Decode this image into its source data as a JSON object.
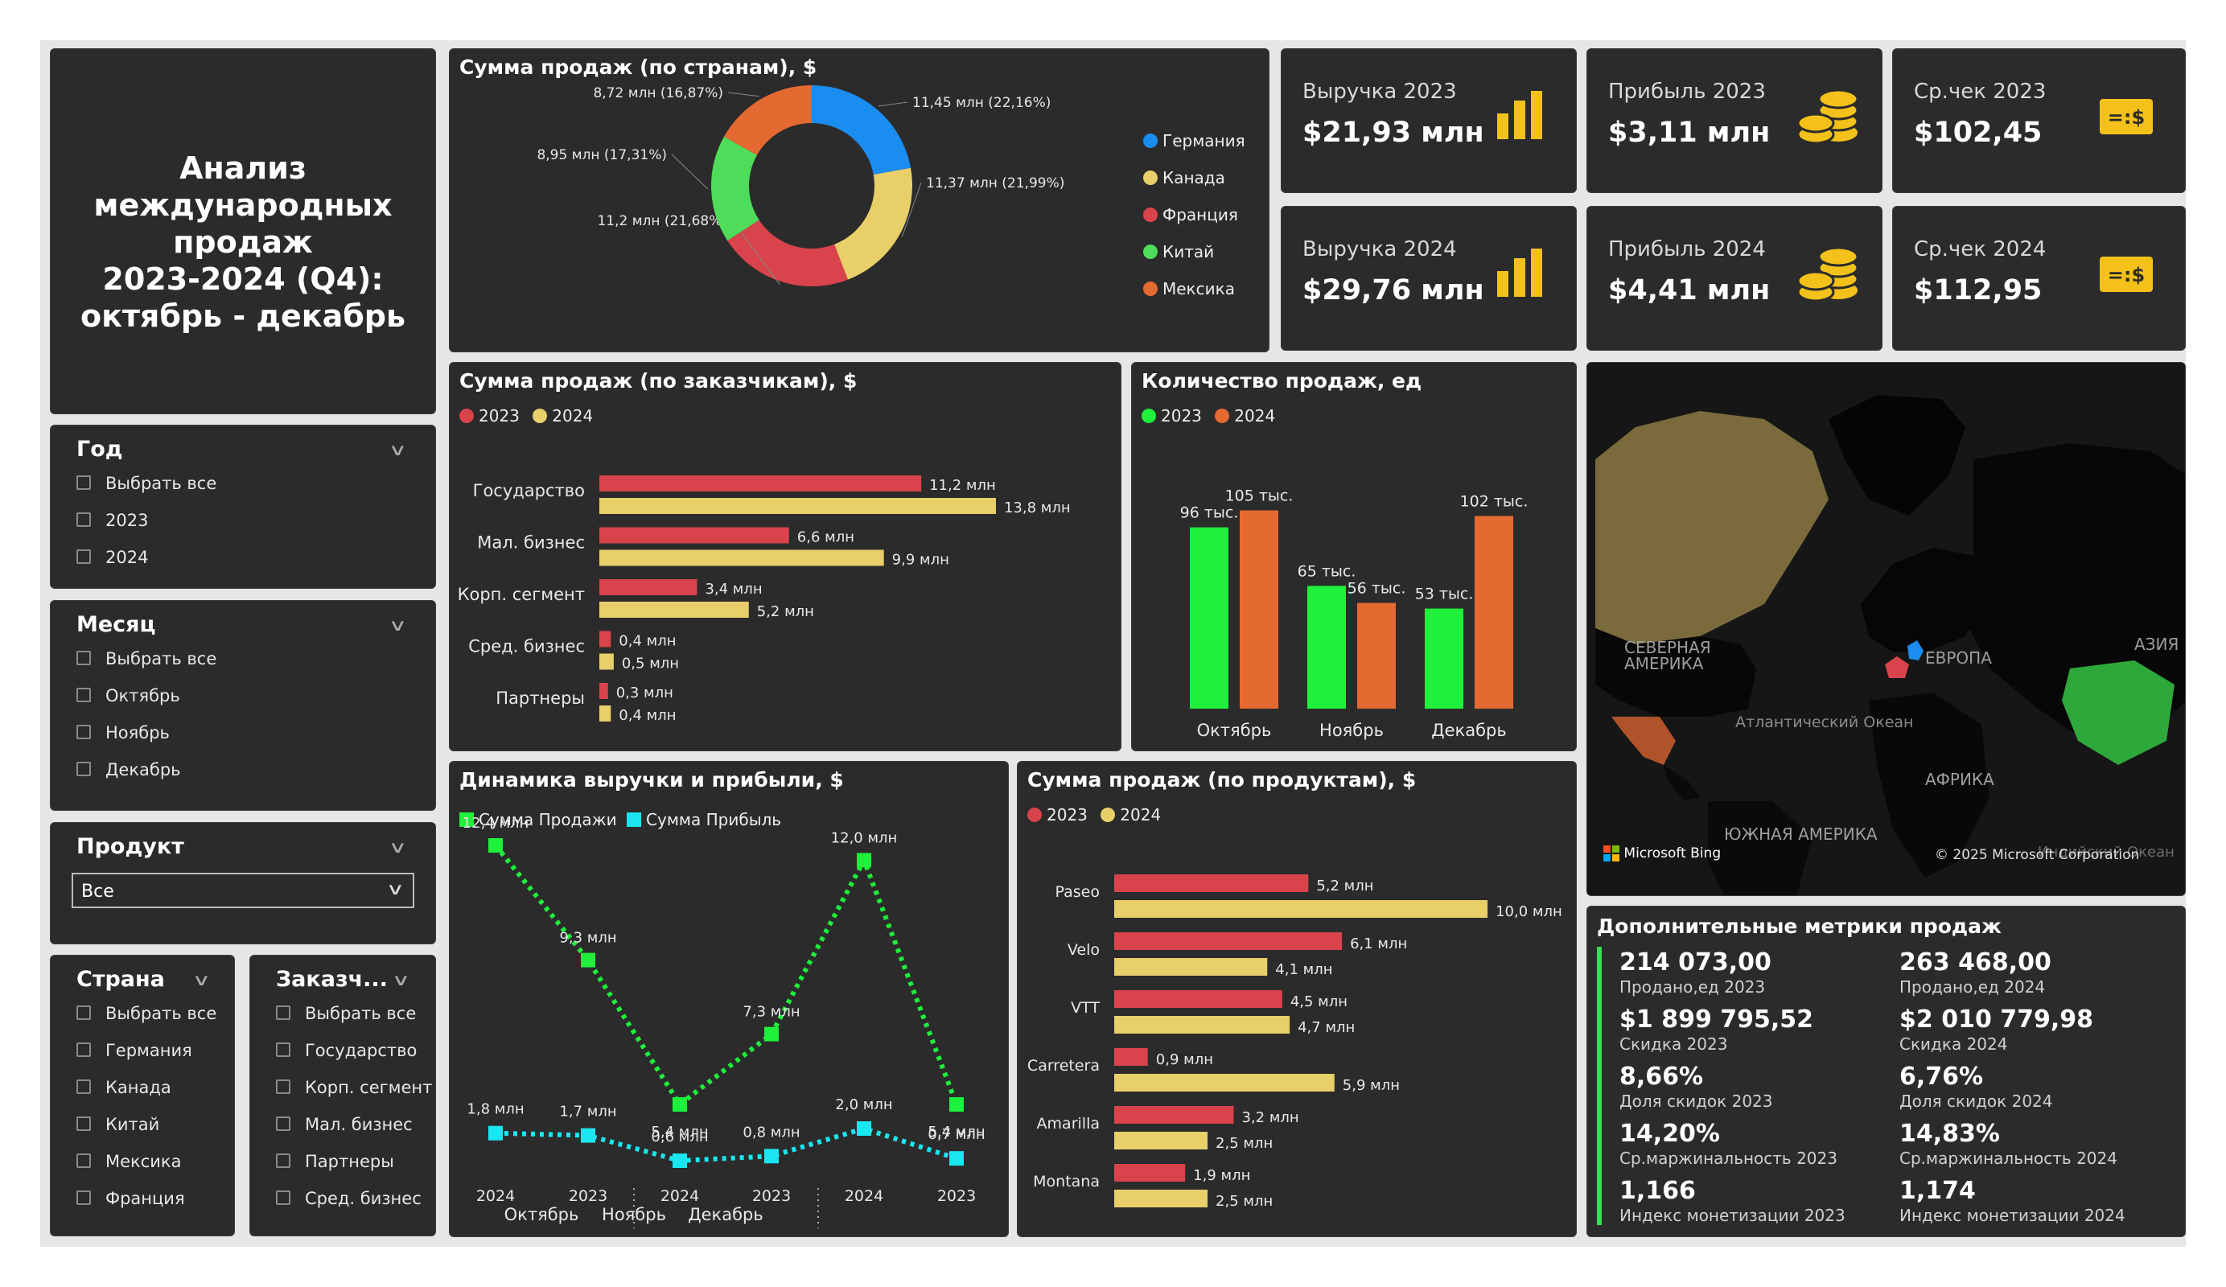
{
  "title_block": {
    "line1": "Анализ",
    "line2": "международных",
    "line3": "продаж",
    "line4": "2023-2024 (Q4):",
    "line5": "октябрь - декабрь"
  },
  "slicers": {
    "year": {
      "title": "Год",
      "options": [
        "Выбрать все",
        "2023",
        "2024"
      ]
    },
    "month": {
      "title": "Месяц",
      "options": [
        "Выбрать все",
        "Октябрь",
        "Ноябрь",
        "Декабрь"
      ]
    },
    "product": {
      "title": "Продукт",
      "selected": "Все"
    },
    "country": {
      "title": "Страна",
      "options": [
        "Выбрать все",
        "Германия",
        "Канада",
        "Китай",
        "Мексика",
        "Франция"
      ]
    },
    "customer": {
      "title": "Заказч...",
      "options": [
        "Выбрать все",
        "Государство",
        "Корп. сегмент",
        "Мал. бизнес",
        "Партнеры",
        "Сред. бизнес"
      ]
    }
  },
  "kpis": {
    "rev23": {
      "label": "Выручка 2023",
      "value": "$21,93 млн",
      "icon": "bar-chart-icon"
    },
    "prof23": {
      "label": "Прибыль 2023",
      "value": "$3,11 млн",
      "icon": "coins-icon"
    },
    "chk23": {
      "label": "Ср.чек 2023",
      "value": "$102,45",
      "icon": "cash-icon"
    },
    "rev24": {
      "label": "Выручка 2024",
      "value": "$29,76 млн",
      "icon": "bar-chart-icon"
    },
    "prof24": {
      "label": "Прибыль 2024",
      "value": "$4,41 млн",
      "icon": "coins-icon"
    },
    "chk24": {
      "label": "Ср.чек 2024",
      "value": "$112,95",
      "icon": "cash-icon"
    }
  },
  "colors": {
    "y2023": "#d9434b",
    "y2024": "#e8cf6a",
    "green": "#1ef03b",
    "orange": "#e46a32",
    "cyan": "#19e6f0",
    "germany": "#1b8cf0",
    "canada": "#e8cf6a",
    "france": "#d9434b",
    "china": "#4fdc5a",
    "mexico": "#e46a32"
  },
  "donut": {
    "title": "Сумма продаж (по странам), $",
    "legend": [
      "Германия",
      "Канада",
      "Франция",
      "Китай",
      "Мексика"
    ],
    "labels": [
      "11,45 млн (22,16%)",
      "11,37 млн (21,99%)",
      "11,2 млн (21,68%)",
      "8,95 млн (17,31%)",
      "8,72 млн (16,87%)"
    ]
  },
  "customers": {
    "title": "Сумма продаж (по заказчикам), $",
    "legend": [
      "2023",
      "2024"
    ],
    "categories": [
      "Государство",
      "Мал. бизнес",
      "Корп. сегмент",
      "Сред. бизнес",
      "Партнеры"
    ],
    "labels2023": [
      "11,2 млн",
      "6,6 млн",
      "3,4 млн",
      "0,4 млн",
      "0,3 млн"
    ],
    "labels2024": [
      "13,8 млн",
      "9,9 млн",
      "5,2 млн",
      "0,5 млн",
      "0,4 млн"
    ]
  },
  "count": {
    "title": "Количество продаж, ед",
    "legend": [
      "2023",
      "2024"
    ],
    "categories": [
      "Октябрь",
      "Ноябрь",
      "Декабрь"
    ],
    "labels2023": [
      "96 тыс.",
      "65 тыс.",
      "53 тыс."
    ],
    "labels2024": [
      "105 тыс.",
      "56 тыс.",
      "102 тыс."
    ]
  },
  "map": {
    "labels": [
      "СЕВЕРНАЯ АМЕРИКА",
      "ЕВРОПА",
      "АЗИЯ",
      "Атлантический Океан",
      "АФРИКА",
      "ЮЖНАЯ АМЕРИКА",
      "Индийский Океан"
    ],
    "bing": "Microsoft Bing",
    "copyright": "© 2025 Microsoft Corporation"
  },
  "dynamics": {
    "title": "Динамика выручки и прибыли, $",
    "legend": [
      "Сумма Продажи",
      "Сумма Прибыль"
    ],
    "years": [
      "2024",
      "2023",
      "2024",
      "2023",
      "2024",
      "2023"
    ],
    "months": [
      "Октябрь",
      "Ноябрь",
      "Декабрь"
    ],
    "sales_labels": [
      "12,4 млн",
      "9,3 млн",
      "5,4 млн",
      "7,3 млн",
      "12,0 млн",
      "5,4 млн"
    ],
    "profit_labels": [
      "1,8 млн",
      "1,7 млн",
      "0,6 млн",
      "0,8 млн",
      "2,0 млн",
      "0,7 млн"
    ]
  },
  "products": {
    "title": "Сумма продаж (по продуктам), $",
    "legend": [
      "2023",
      "2024"
    ],
    "categories": [
      "Paseo",
      "Velo",
      "VTT",
      "Carretera",
      "Amarilla",
      "Montana"
    ],
    "labels2023": [
      "5,2 млн",
      "6,1 млн",
      "4,5 млн",
      "0,9 млн",
      "3,2 млн",
      "1,9 млн"
    ],
    "labels2024": [
      "10,0 млн",
      "4,1 млн",
      "4,7 млн",
      "5,9 млн",
      "2,5 млн",
      "2,5 млн"
    ]
  },
  "metrics": {
    "title": "Дополнительные метрики продаж",
    "left": [
      {
        "value": "214 073,00",
        "label": "Продано,ед 2023"
      },
      {
        "value": "$1 899 795,52",
        "label": "Скидка 2023"
      },
      {
        "value": "8,66%",
        "label": "Доля скидок 2023"
      },
      {
        "value": "14,20%",
        "label": "Ср.маржинальность 2023"
      },
      {
        "value": "1,166",
        "label": "Индекс монетизации 2023"
      }
    ],
    "right": [
      {
        "value": "263 468,00",
        "label": "Продано,ед 2024"
      },
      {
        "value": "$2 010 779,98",
        "label": "Скидка 2024"
      },
      {
        "value": "6,76%",
        "label": "Доля скидок 2024"
      },
      {
        "value": "14,83%",
        "label": "Ср.маржинальность 2024"
      },
      {
        "value": "1,174",
        "label": "Индекс монетизации 2024"
      }
    ]
  },
  "chart_data": [
    {
      "type": "pie",
      "title": "Сумма продаж (по странам), $",
      "categories": [
        "Германия",
        "Канада",
        "Франция",
        "Китай",
        "Мексика"
      ],
      "values": [
        11.45,
        11.37,
        11.2,
        8.95,
        8.72
      ],
      "percent": [
        22.16,
        21.99,
        21.68,
        17.31,
        16.87
      ],
      "unit": "млн $"
    },
    {
      "type": "bar",
      "orientation": "horizontal",
      "title": "Сумма продаж (по заказчикам), $",
      "categories": [
        "Государство",
        "Мал. бизнес",
        "Корп. сегмент",
        "Сред. бизнес",
        "Партнеры"
      ],
      "series": [
        {
          "name": "2023",
          "values": [
            11.2,
            6.6,
            3.4,
            0.4,
            0.3
          ]
        },
        {
          "name": "2024",
          "values": [
            13.8,
            9.9,
            5.2,
            0.5,
            0.4
          ]
        }
      ],
      "xlim": [
        0,
        14.5
      ]
    },
    {
      "type": "bar",
      "title": "Количество продаж, ед",
      "categories": [
        "Октябрь",
        "Ноябрь",
        "Декабрь"
      ],
      "series": [
        {
          "name": "2023",
          "values": [
            96,
            65,
            53
          ]
        },
        {
          "name": "2024",
          "values": [
            105,
            56,
            102
          ]
        }
      ],
      "ylim": [
        0,
        115
      ]
    },
    {
      "type": "line",
      "title": "Динамика выручки и прибыли, $",
      "x": [
        "Октябрь 2024",
        "Октябрь 2023",
        "Ноябрь 2024",
        "Ноябрь 2023",
        "Декабрь 2024",
        "Декабрь 2023"
      ],
      "series": [
        {
          "name": "Сумма Продажи",
          "values": [
            12.4,
            9.3,
            5.4,
            7.3,
            12.0,
            5.4
          ]
        },
        {
          "name": "Сумма Прибыль",
          "values": [
            1.8,
            1.7,
            0.6,
            0.8,
            2.0,
            0.7
          ]
        }
      ]
    },
    {
      "type": "bar",
      "orientation": "horizontal",
      "title": "Сумма продаж (по продуктам), $",
      "categories": [
        "Paseo",
        "Velo",
        "VTT",
        "Carretera",
        "Amarilla",
        "Montana"
      ],
      "series": [
        {
          "name": "2023",
          "values": [
            5.2,
            6.1,
            4.5,
            0.9,
            3.2,
            1.9
          ]
        },
        {
          "name": "2024",
          "values": [
            10.0,
            4.1,
            4.7,
            5.9,
            2.5,
            2.5
          ]
        }
      ],
      "xlim": [
        0,
        10.3
      ]
    }
  ]
}
